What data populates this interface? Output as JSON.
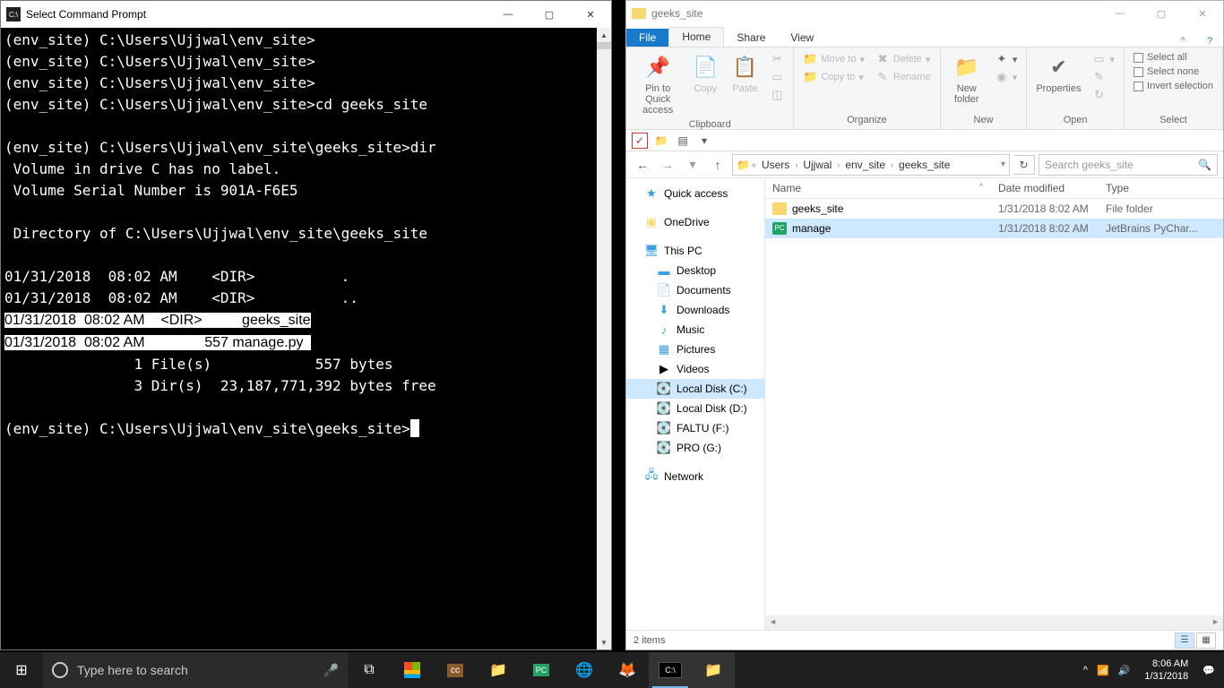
{
  "cmd": {
    "title": "Select Command Prompt",
    "lines": [
      "(env_site) C:\\Users\\Ujjwal\\env_site>",
      "(env_site) C:\\Users\\Ujjwal\\env_site>",
      "(env_site) C:\\Users\\Ujjwal\\env_site>",
      "(env_site) C:\\Users\\Ujjwal\\env_site>cd geeks_site",
      "",
      "(env_site) C:\\Users\\Ujjwal\\env_site\\geeks_site>dir",
      " Volume in drive C has no label.",
      " Volume Serial Number is 901A-F6E5",
      "",
      " Directory of C:\\Users\\Ujjwal\\env_site\\geeks_site",
      "",
      "01/31/2018  08:02 AM    <DIR>          .",
      "01/31/2018  08:02 AM    <DIR>          ..",
      "01/31/2018  08:02 AM    <DIR>          geeks_site",
      "01/31/2018  08:02 AM               557 manage.py  ",
      "               1 File(s)            557 bytes",
      "               3 Dir(s)  23,187,771,392 bytes free",
      "",
      "(env_site) C:\\Users\\Ujjwal\\env_site\\geeks_site>"
    ],
    "sel_lines": [
      13,
      14
    ]
  },
  "explorer": {
    "title": "geeks_site",
    "tabs": {
      "file": "File",
      "home": "Home",
      "share": "Share",
      "view": "View"
    },
    "ribbon": {
      "clipboard": {
        "label": "Clipboard",
        "pin": "Pin to Quick access",
        "copy": "Copy",
        "paste": "Paste",
        "cut": "Cut",
        "copypath": "Copy path",
        "pasteshort": "Paste shortcut"
      },
      "organize": {
        "label": "Organize",
        "moveto": "Move to",
        "copyto": "Copy to",
        "delete": "Delete",
        "rename": "Rename"
      },
      "new": {
        "label": "New",
        "newfolder": "New folder"
      },
      "open": {
        "label": "Open",
        "properties": "Properties"
      },
      "select": {
        "label": "Select",
        "all": "Select all",
        "none": "Select none",
        "invert": "Invert selection"
      }
    },
    "breadcrumb": [
      "Users",
      "Ujjwal",
      "env_site",
      "geeks_site"
    ],
    "search_placeholder": "Search geeks_site",
    "nav": {
      "quick": "Quick access",
      "onedrive": "OneDrive",
      "thispc": "This PC",
      "desktop": "Desktop",
      "documents": "Documents",
      "downloads": "Downloads",
      "music": "Music",
      "pictures": "Pictures",
      "videos": "Videos",
      "diskc": "Local Disk (C:)",
      "diskd": "Local Disk (D:)",
      "diskf": "FALTU (F:)",
      "diskg": "PRO (G:)",
      "network": "Network"
    },
    "columns": {
      "name": "Name",
      "date": "Date modified",
      "type": "Type"
    },
    "files": [
      {
        "name": "geeks_site",
        "date": "1/31/2018 8:02 AM",
        "type": "File folder",
        "icon": "folder"
      },
      {
        "name": "manage",
        "date": "1/31/2018 8:02 AM",
        "type": "JetBrains PyChar...",
        "icon": "pc"
      }
    ],
    "status": "2 items"
  },
  "taskbar": {
    "search_placeholder": "Type here to search",
    "time": "8:06 AM",
    "date": "1/31/2018"
  }
}
